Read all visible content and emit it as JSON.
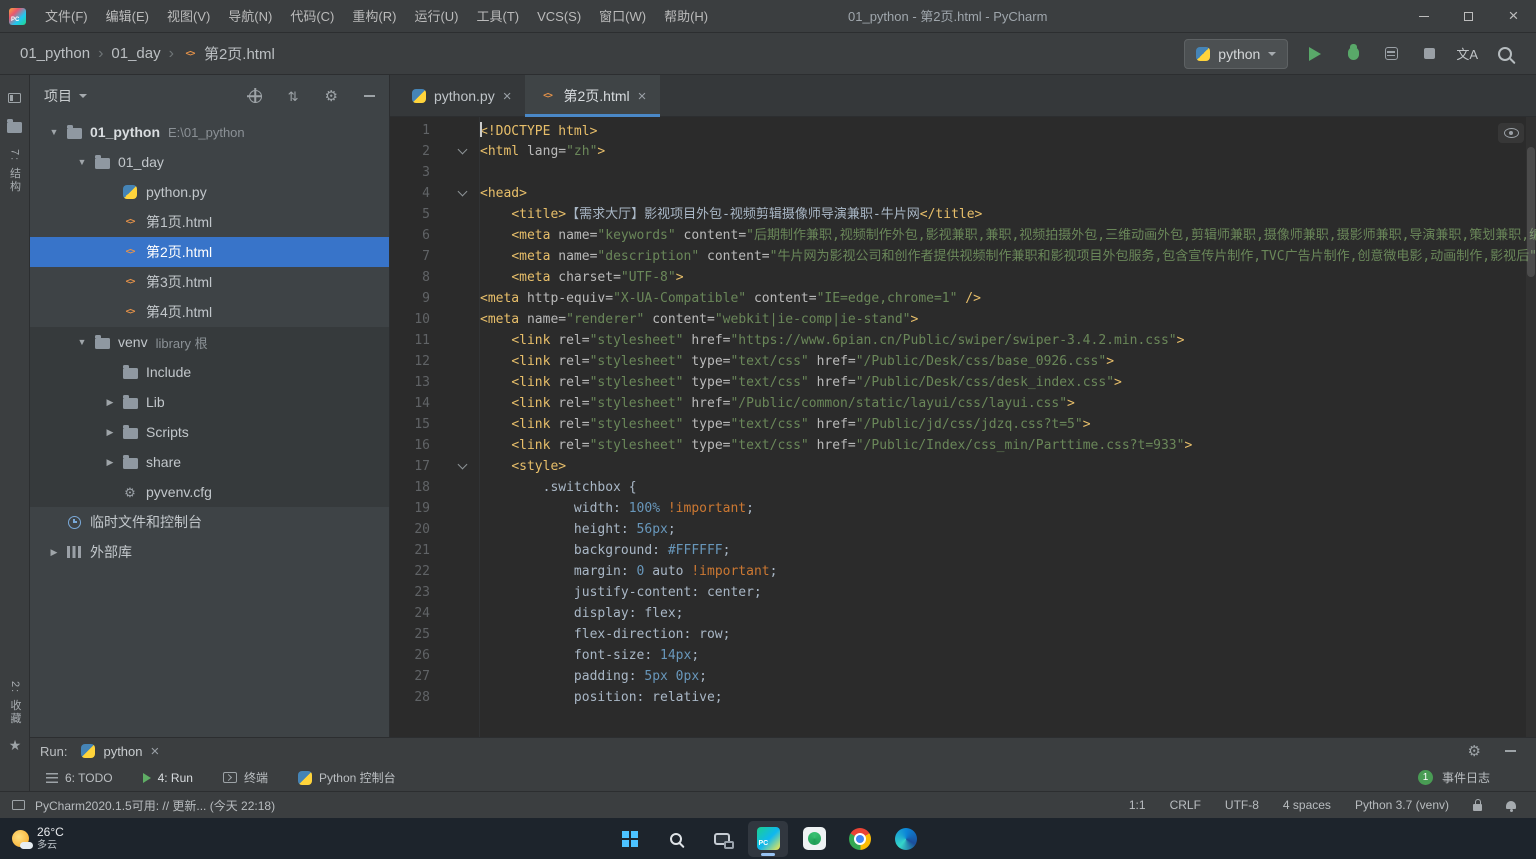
{
  "window": {
    "title": "01_python - 第2页.html - PyCharm",
    "logo_text": "PC"
  },
  "menu_bar": {
    "items": [
      "文件(F)",
      "编辑(E)",
      "视图(V)",
      "导航(N)",
      "代码(C)",
      "重构(R)",
      "运行(U)",
      "工具(T)",
      "VCS(S)",
      "窗口(W)",
      "帮助(H)"
    ]
  },
  "nav_bar": {
    "breadcrumbs": [
      "01_python",
      "01_day",
      "第2页.html"
    ],
    "run_config": "python",
    "translate_glyph": "文A"
  },
  "tool_strip": {
    "structure_label": "7: 结构",
    "favorites_label": "2: 收藏"
  },
  "project_panel": {
    "title": "项目",
    "tree": [
      {
        "label": "01_python",
        "hint": "E:\\01_python",
        "icon": "folder",
        "arrow": "open",
        "indent": 0,
        "bold": true
      },
      {
        "label": "01_day",
        "icon": "folder",
        "arrow": "open",
        "indent": 1
      },
      {
        "label": "python.py",
        "icon": "python",
        "indent": 2
      },
      {
        "label": "第1页.html",
        "icon": "html",
        "indent": 2
      },
      {
        "label": "第2页.html",
        "icon": "html",
        "indent": 2,
        "selected": true
      },
      {
        "label": "第3页.html",
        "icon": "html",
        "indent": 2
      },
      {
        "label": "第4页.html",
        "icon": "html",
        "indent": 2
      },
      {
        "label": "venv",
        "hint": "library 根",
        "icon": "folder",
        "arrow": "open",
        "indent": 1,
        "lib": true
      },
      {
        "label": "Include",
        "icon": "folder",
        "indent": 2,
        "lib": true
      },
      {
        "label": "Lib",
        "icon": "folder",
        "arrow": "closed",
        "indent": 2,
        "lib": true
      },
      {
        "label": "Scripts",
        "icon": "folder",
        "arrow": "closed",
        "indent": 2,
        "lib": true
      },
      {
        "label": "share",
        "icon": "folder",
        "arrow": "closed",
        "indent": 2,
        "lib": true
      },
      {
        "label": "pyvenv.cfg",
        "icon": "cfg",
        "indent": 2,
        "lib": true
      },
      {
        "label": "临时文件和控制台",
        "icon": "clock",
        "indent": 0
      },
      {
        "label": "外部库",
        "icon": "libs",
        "arrow": "closed",
        "indent": 0
      }
    ]
  },
  "editor": {
    "tabs": [
      {
        "label": "python.py",
        "icon": "python",
        "active": false
      },
      {
        "label": "第2页.html",
        "icon": "html",
        "active": true
      }
    ],
    "lines": [
      {
        "n": 1,
        "caret": true,
        "segs": [
          [
            "t",
            "<!DOCTYPE html>"
          ]
        ]
      },
      {
        "n": 2,
        "fold": true,
        "segs": [
          [
            "t",
            "<html"
          ],
          [
            "a",
            " lang="
          ],
          [
            "s",
            "\"zh\""
          ],
          [
            "t",
            ">"
          ]
        ]
      },
      {
        "n": 3,
        "segs": []
      },
      {
        "n": 4,
        "fold": true,
        "segs": [
          [
            "t",
            "<head>"
          ]
        ]
      },
      {
        "n": 5,
        "segs": [
          [
            "x",
            "    "
          ],
          [
            "t",
            "<title>"
          ],
          [
            "x",
            "【需求大厅】影视项目外包-视频剪辑摄像师导演兼职-牛片网"
          ],
          [
            "t",
            "</title>"
          ]
        ]
      },
      {
        "n": 6,
        "segs": [
          [
            "x",
            "    "
          ],
          [
            "t",
            "<meta"
          ],
          [
            "a",
            " name="
          ],
          [
            "s",
            "\"keywords\""
          ],
          [
            "a",
            " content="
          ],
          [
            "s",
            "\"后期制作兼职,视频制作外包,影视兼职,兼职,视频拍摄外包,三维动画外包,剪辑师兼职,摄像师兼职,摄影师兼职,导演兼职,策划兼职,编\""
          ]
        ]
      },
      {
        "n": 7,
        "segs": [
          [
            "x",
            "    "
          ],
          [
            "t",
            "<meta"
          ],
          [
            "a",
            " name="
          ],
          [
            "s",
            "\"description\""
          ],
          [
            "a",
            " content="
          ],
          [
            "s",
            "\"牛片网为影视公司和创作者提供视频制作兼职和影视项目外包服务,包含宣传片制作,TVC广告片制作,创意微电影,动画制作,影视后\""
          ]
        ]
      },
      {
        "n": 8,
        "segs": [
          [
            "x",
            "    "
          ],
          [
            "t",
            "<meta"
          ],
          [
            "a",
            " charset="
          ],
          [
            "s",
            "\"UTF-8\""
          ],
          [
            "t",
            ">"
          ]
        ]
      },
      {
        "n": 9,
        "segs": [
          [
            "t",
            "<meta"
          ],
          [
            "a",
            " http-equiv="
          ],
          [
            "s",
            "\"X-UA-Compatible\""
          ],
          [
            "a",
            " content="
          ],
          [
            "s",
            "\"IE=edge,chrome=1\""
          ],
          [
            "t",
            " />"
          ]
        ]
      },
      {
        "n": 10,
        "segs": [
          [
            "t",
            "<meta"
          ],
          [
            "a",
            " name="
          ],
          [
            "s",
            "\"renderer\""
          ],
          [
            "a",
            " content="
          ],
          [
            "s",
            "\"webkit|ie-comp|ie-stand\""
          ],
          [
            "t",
            ">"
          ]
        ]
      },
      {
        "n": 11,
        "segs": [
          [
            "x",
            "    "
          ],
          [
            "t",
            "<link"
          ],
          [
            "a",
            " rel="
          ],
          [
            "s",
            "\"stylesheet\""
          ],
          [
            "a",
            " href="
          ],
          [
            "s",
            "\"https://www.6pian.cn/Public/swiper/swiper-3.4.2.min.css\""
          ],
          [
            "t",
            ">"
          ]
        ]
      },
      {
        "n": 12,
        "segs": [
          [
            "x",
            "    "
          ],
          [
            "t",
            "<link"
          ],
          [
            "a",
            " rel="
          ],
          [
            "s",
            "\"stylesheet\""
          ],
          [
            "a",
            " type="
          ],
          [
            "s",
            "\"text/css\""
          ],
          [
            "a",
            " href="
          ],
          [
            "s",
            "\"/Public/Desk/css/base_0926.css\""
          ],
          [
            "t",
            ">"
          ]
        ]
      },
      {
        "n": 13,
        "segs": [
          [
            "x",
            "    "
          ],
          [
            "t",
            "<link"
          ],
          [
            "a",
            " rel="
          ],
          [
            "s",
            "\"stylesheet\""
          ],
          [
            "a",
            " type="
          ],
          [
            "s",
            "\"text/css\""
          ],
          [
            "a",
            " href="
          ],
          [
            "s",
            "\"/Public/Desk/css/desk_index.css\""
          ],
          [
            "t",
            ">"
          ]
        ]
      },
      {
        "n": 14,
        "segs": [
          [
            "x",
            "    "
          ],
          [
            "t",
            "<link"
          ],
          [
            "a",
            " rel="
          ],
          [
            "s",
            "\"stylesheet\""
          ],
          [
            "a",
            " href="
          ],
          [
            "s",
            "\"/Public/common/static/layui/css/layui.css\""
          ],
          [
            "t",
            ">"
          ]
        ]
      },
      {
        "n": 15,
        "segs": [
          [
            "x",
            "    "
          ],
          [
            "t",
            "<link"
          ],
          [
            "a",
            " rel="
          ],
          [
            "s",
            "\"stylesheet\""
          ],
          [
            "a",
            " type="
          ],
          [
            "s",
            "\"text/css\""
          ],
          [
            "a",
            " href="
          ],
          [
            "s",
            "\"/Public/jd/css/jdzq.css?t=5\""
          ],
          [
            "t",
            ">"
          ]
        ]
      },
      {
        "n": 16,
        "segs": [
          [
            "x",
            "    "
          ],
          [
            "t",
            "<link"
          ],
          [
            "a",
            " rel="
          ],
          [
            "s",
            "\"stylesheet\""
          ],
          [
            "a",
            " type="
          ],
          [
            "s",
            "\"text/css\""
          ],
          [
            "a",
            " href="
          ],
          [
            "s",
            "\"/Public/Index/css_min/Parttime.css?t=933\""
          ],
          [
            "t",
            ">"
          ]
        ]
      },
      {
        "n": 17,
        "fold": true,
        "segs": [
          [
            "x",
            "    "
          ],
          [
            "t",
            "<style>"
          ]
        ]
      },
      {
        "n": 18,
        "segs": [
          [
            "x",
            "        .switchbox {"
          ]
        ]
      },
      {
        "n": 19,
        "segs": [
          [
            "x",
            "            width: "
          ],
          [
            "n",
            "100%"
          ],
          [
            "k",
            " !important"
          ],
          [
            "x",
            ";"
          ]
        ]
      },
      {
        "n": 20,
        "segs": [
          [
            "x",
            "            height: "
          ],
          [
            "n",
            "56px"
          ],
          [
            "x",
            ";"
          ]
        ]
      },
      {
        "n": 21,
        "segs": [
          [
            "x",
            "            background: "
          ],
          [
            "n",
            "#FFFFFF"
          ],
          [
            "x",
            ";"
          ]
        ]
      },
      {
        "n": 22,
        "segs": [
          [
            "x",
            "            margin: "
          ],
          [
            "n",
            "0"
          ],
          [
            "x",
            " auto"
          ],
          [
            "k",
            " !important"
          ],
          [
            "x",
            ";"
          ]
        ]
      },
      {
        "n": 23,
        "segs": [
          [
            "x",
            "            justify-content: center;"
          ]
        ]
      },
      {
        "n": 24,
        "segs": [
          [
            "x",
            "            display: flex;"
          ]
        ]
      },
      {
        "n": 25,
        "segs": [
          [
            "x",
            "            flex-direction: row;"
          ]
        ]
      },
      {
        "n": 26,
        "segs": [
          [
            "x",
            "            font-size: "
          ],
          [
            "n",
            "14px"
          ],
          [
            "x",
            ";"
          ]
        ]
      },
      {
        "n": 27,
        "segs": [
          [
            "x",
            "            padding: "
          ],
          [
            "n",
            "5px 0px"
          ],
          [
            "x",
            ";"
          ]
        ]
      },
      {
        "n": 28,
        "segs": [
          [
            "x",
            "            position: relative;"
          ]
        ]
      }
    ]
  },
  "run_panel": {
    "label": "Run:",
    "config": "python"
  },
  "bottom_bar": {
    "items": [
      {
        "icon": "todo",
        "label": "6: TODO"
      },
      {
        "icon": "run",
        "label": "4: Run",
        "active": true
      },
      {
        "icon": "terminal",
        "label": "终端"
      },
      {
        "icon": "python",
        "label": "Python 控制台"
      }
    ],
    "event_badge": "1",
    "event_label": "事件日志"
  },
  "status_bar": {
    "message": "PyCharm2020.1.5可用: // 更新... (今天 22:18)",
    "items": [
      {
        "name": "caret-position",
        "label": "1:1"
      },
      {
        "name": "line-separator",
        "label": "CRLF"
      },
      {
        "name": "file-encoding",
        "label": "UTF-8"
      },
      {
        "name": "indent-style",
        "label": "4 spaces"
      },
      {
        "name": "python-interpreter",
        "label": "Python 3.7 (venv)"
      }
    ]
  },
  "taskbar": {
    "weather_temp": "26°C",
    "weather_desc": "多云",
    "icons": [
      {
        "name": "start"
      },
      {
        "name": "search"
      },
      {
        "name": "task-view"
      },
      {
        "name": "pycharm",
        "active": true
      },
      {
        "name": "app-green"
      },
      {
        "name": "chrome"
      },
      {
        "name": "edge"
      }
    ]
  },
  "colors": {
    "selection": "#3874c9",
    "tab_underline": "#4a88c7",
    "run_green": "#59a869",
    "editor_bg": "#2b2b2b"
  }
}
